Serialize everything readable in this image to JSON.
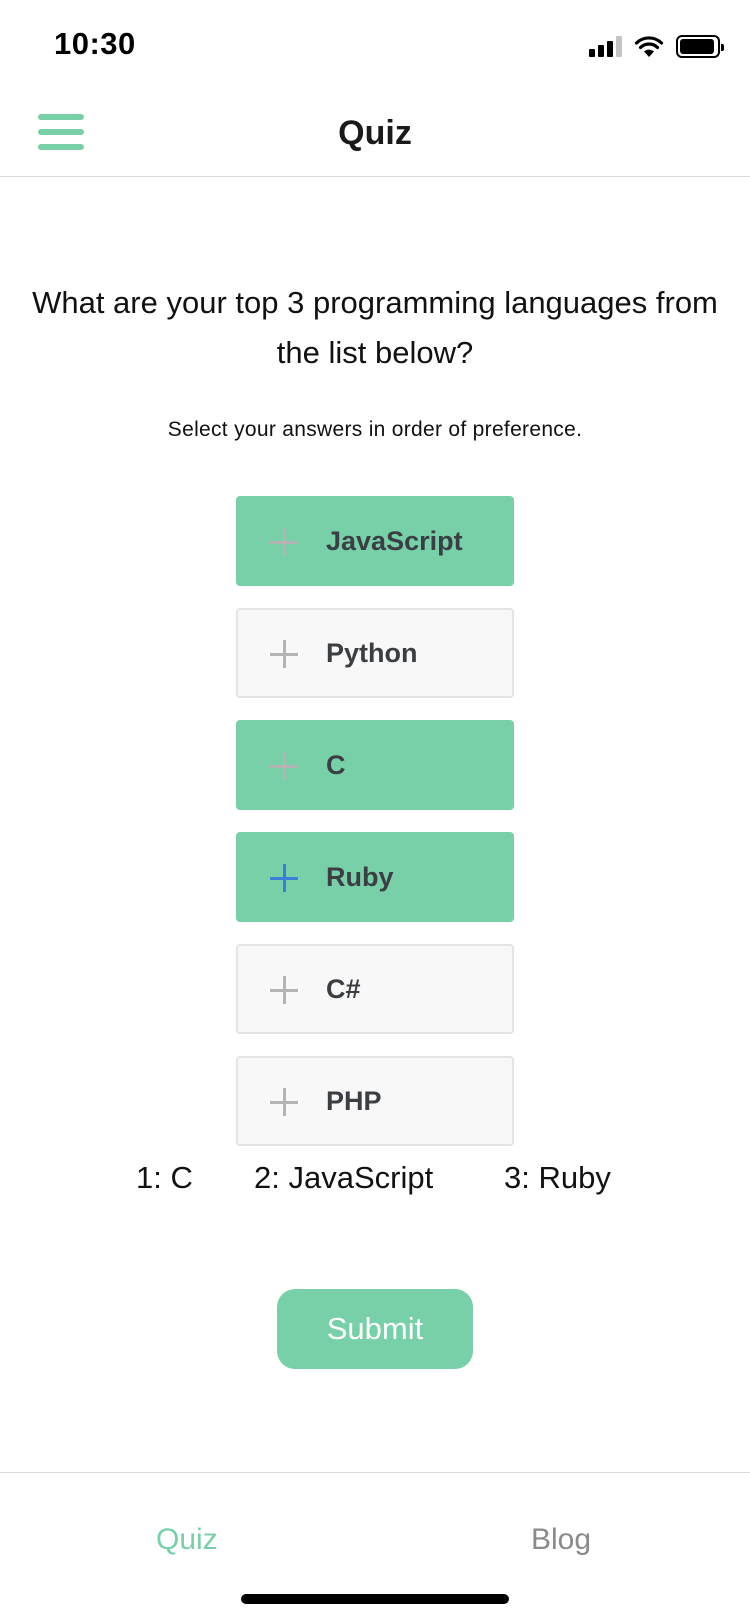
{
  "status_bar": {
    "time": "10:30",
    "icons": [
      "signal-icon",
      "wifi-icon",
      "battery-icon"
    ]
  },
  "header": {
    "title": "Quiz",
    "menu_icon": "hamburger-menu-icon"
  },
  "quiz": {
    "question": "What are your top 3 programming languages from the list below?",
    "instruction": "Select your answers in order of preference.",
    "options": [
      {
        "label": "JavaScript",
        "selected": true
      },
      {
        "label": "Python",
        "selected": false
      },
      {
        "label": "C",
        "selected": true
      },
      {
        "label": "Ruby",
        "selected": true
      },
      {
        "label": "C#",
        "selected": false
      },
      {
        "label": "PHP",
        "selected": false
      }
    ],
    "rankings": [
      "1: C",
      "2: JavaScript",
      "3: Ruby"
    ],
    "submit_label": "Submit"
  },
  "tabs": [
    {
      "label": "Quiz",
      "active": true
    },
    {
      "label": "Blog",
      "active": false
    }
  ],
  "colors": {
    "accent": "#77d0a8",
    "active_plus": "#3b7fd9",
    "inactive_tab": "#8a8a8a"
  }
}
